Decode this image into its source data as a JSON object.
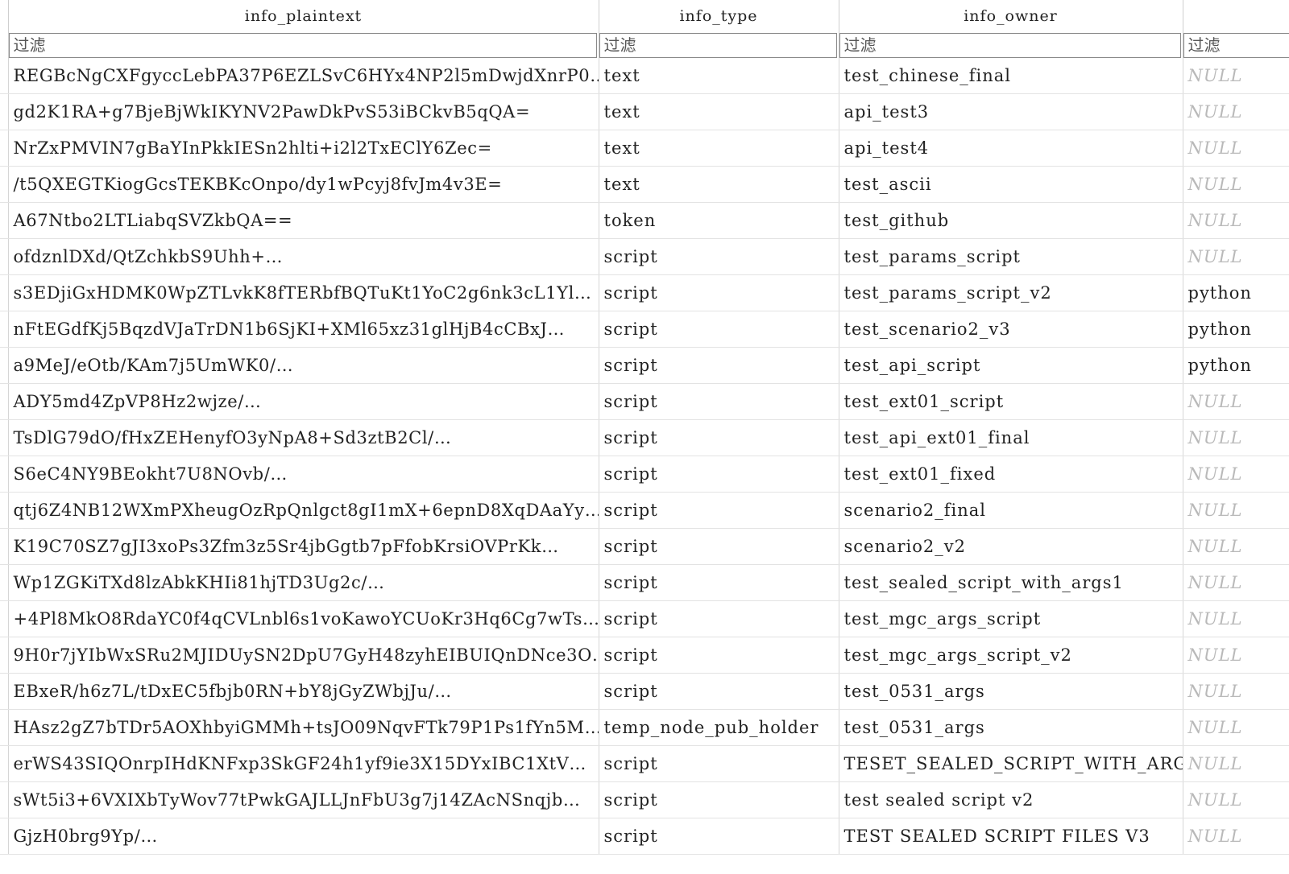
{
  "columns": [
    {
      "header": "info_plaintext",
      "filter_placeholder": "过滤"
    },
    {
      "header": "info_type",
      "filter_placeholder": "过滤"
    },
    {
      "header": "info_owner",
      "filter_placeholder": "过滤"
    },
    {
      "header": "",
      "filter_placeholder": "过滤"
    }
  ],
  "rows": [
    {
      "plaintext": "REGBcNgCXFgyccLebPA37P6EZLSvC6HYx4NP2l5mDwjdXnrP0…",
      "type": "text",
      "owner": "test_chinese_final",
      "extra": "NULL",
      "extra_is_null": true
    },
    {
      "plaintext": "gd2K1RA+g7BjeBjWkIKYNV2PawDkPvS53iBCkvB5qQA=",
      "type": "text",
      "owner": "api_test3",
      "extra": "NULL",
      "extra_is_null": true
    },
    {
      "plaintext": "NrZxPMVIN7gBaYInPkkIESn2hlti+i2l2TxEClY6Zec=",
      "type": "text",
      "owner": "api_test4",
      "extra": "NULL",
      "extra_is_null": true
    },
    {
      "plaintext": "/t5QXEGTKiogGcsTEKBKcOnpo/dy1wPcyj8fvJm4v3E=",
      "type": "text",
      "owner": "test_ascii",
      "extra": "NULL",
      "extra_is_null": true
    },
    {
      "plaintext": "A67Ntbo2LTLiabqSVZkbQA==",
      "type": "token",
      "owner": "test_github",
      "extra": "NULL",
      "extra_is_null": true
    },
    {
      "plaintext": "ofdznlDXd/QtZchkbS9Uhh+…",
      "type": "script",
      "owner": "test_params_script",
      "extra": "NULL",
      "extra_is_null": true
    },
    {
      "plaintext": "s3EDjiGxHDMK0WpZTLvkK8fTERbfBQTuKt1YoC2g6nk3cL1Yl…",
      "type": "script",
      "owner": "test_params_script_v2",
      "extra": "python",
      "extra_is_null": false
    },
    {
      "plaintext": "nFtEGdfKj5BqzdVJaTrDN1b6SjKI+XMl65xz31glHjB4cCBxJ…",
      "type": "script",
      "owner": "test_scenario2_v3",
      "extra": "python",
      "extra_is_null": false
    },
    {
      "plaintext": "a9MeJ/eOtb/KAm7j5UmWK0/…",
      "type": "script",
      "owner": "test_api_script",
      "extra": "python",
      "extra_is_null": false
    },
    {
      "plaintext": "ADY5md4ZpVP8Hz2wjze/…",
      "type": "script",
      "owner": "test_ext01_script",
      "extra": "NULL",
      "extra_is_null": true
    },
    {
      "plaintext": "TsDlG79dO/fHxZEHenyfO3yNpA8+Sd3ztB2Cl/…",
      "type": "script",
      "owner": "test_api_ext01_final",
      "extra": "NULL",
      "extra_is_null": true
    },
    {
      "plaintext": "S6eC4NY9BEokht7U8NOvb/…",
      "type": "script",
      "owner": "test_ext01_fixed",
      "extra": "NULL",
      "extra_is_null": true
    },
    {
      "plaintext": "qtj6Z4NB12WXmPXheugOzRpQnlgct8gI1mX+6epnD8XqDAaYy…",
      "type": "script",
      "owner": "scenario2_final",
      "extra": "NULL",
      "extra_is_null": true
    },
    {
      "plaintext": "K19C70SZ7gJI3xoPs3Zfm3z5Sr4jbGgtb7pFfobKrsiOVPrKk…",
      "type": "script",
      "owner": "scenario2_v2",
      "extra": "NULL",
      "extra_is_null": true
    },
    {
      "plaintext": "Wp1ZGKiTXd8lzAbkKHIi81hjTD3Ug2c/…",
      "type": "script",
      "owner": "test_sealed_script_with_args1",
      "extra": "NULL",
      "extra_is_null": true
    },
    {
      "plaintext": "+4Pl8MkO8RdaYC0f4qCVLnbl6s1voKawoYCUoKr3Hq6Cg7wTs…",
      "type": "script",
      "owner": "test_mgc_args_script",
      "extra": "NULL",
      "extra_is_null": true
    },
    {
      "plaintext": "9H0r7jYIbWxSRu2MJIDUySN2DpU7GyH48zyhEIBUIQnDNce3O…",
      "type": "script",
      "owner": "test_mgc_args_script_v2",
      "extra": "NULL",
      "extra_is_null": true
    },
    {
      "plaintext": "EBxeR/h6z7L/tDxEC5fbjb0RN+bY8jGyZWbjJu/…",
      "type": "script",
      "owner": "test_0531_args",
      "extra": "NULL",
      "extra_is_null": true
    },
    {
      "plaintext": "HAsz2gZ7bTDr5AOXhbyiGMMh+tsJO09NqvFTk79P1Ps1fYn5M…",
      "type": "temp_node_pub_holder",
      "owner": "test_0531_args",
      "extra": "NULL",
      "extra_is_null": true
    },
    {
      "plaintext": "erWS43SIQOnrpIHdKNFxp3SkGF24h1yf9ie3X15DYxIBC1XtV…",
      "type": "script",
      "owner": "TESET_SEALED_SCRIPT_WITH_ARGS",
      "extra": "NULL",
      "extra_is_null": true
    },
    {
      "plaintext": "sWt5i3+6VXIXbTyWov77tPwkGAJLLJnFbU3g7j14ZAcNSnqjb…",
      "type": "script",
      "owner": "test sealed script v2",
      "extra": "NULL",
      "extra_is_null": true
    },
    {
      "plaintext": "GjzH0brg9Yp/…",
      "type": "script",
      "owner": "TEST SEALED SCRIPT FILES V3",
      "extra": "NULL",
      "extra_is_null": true
    }
  ]
}
